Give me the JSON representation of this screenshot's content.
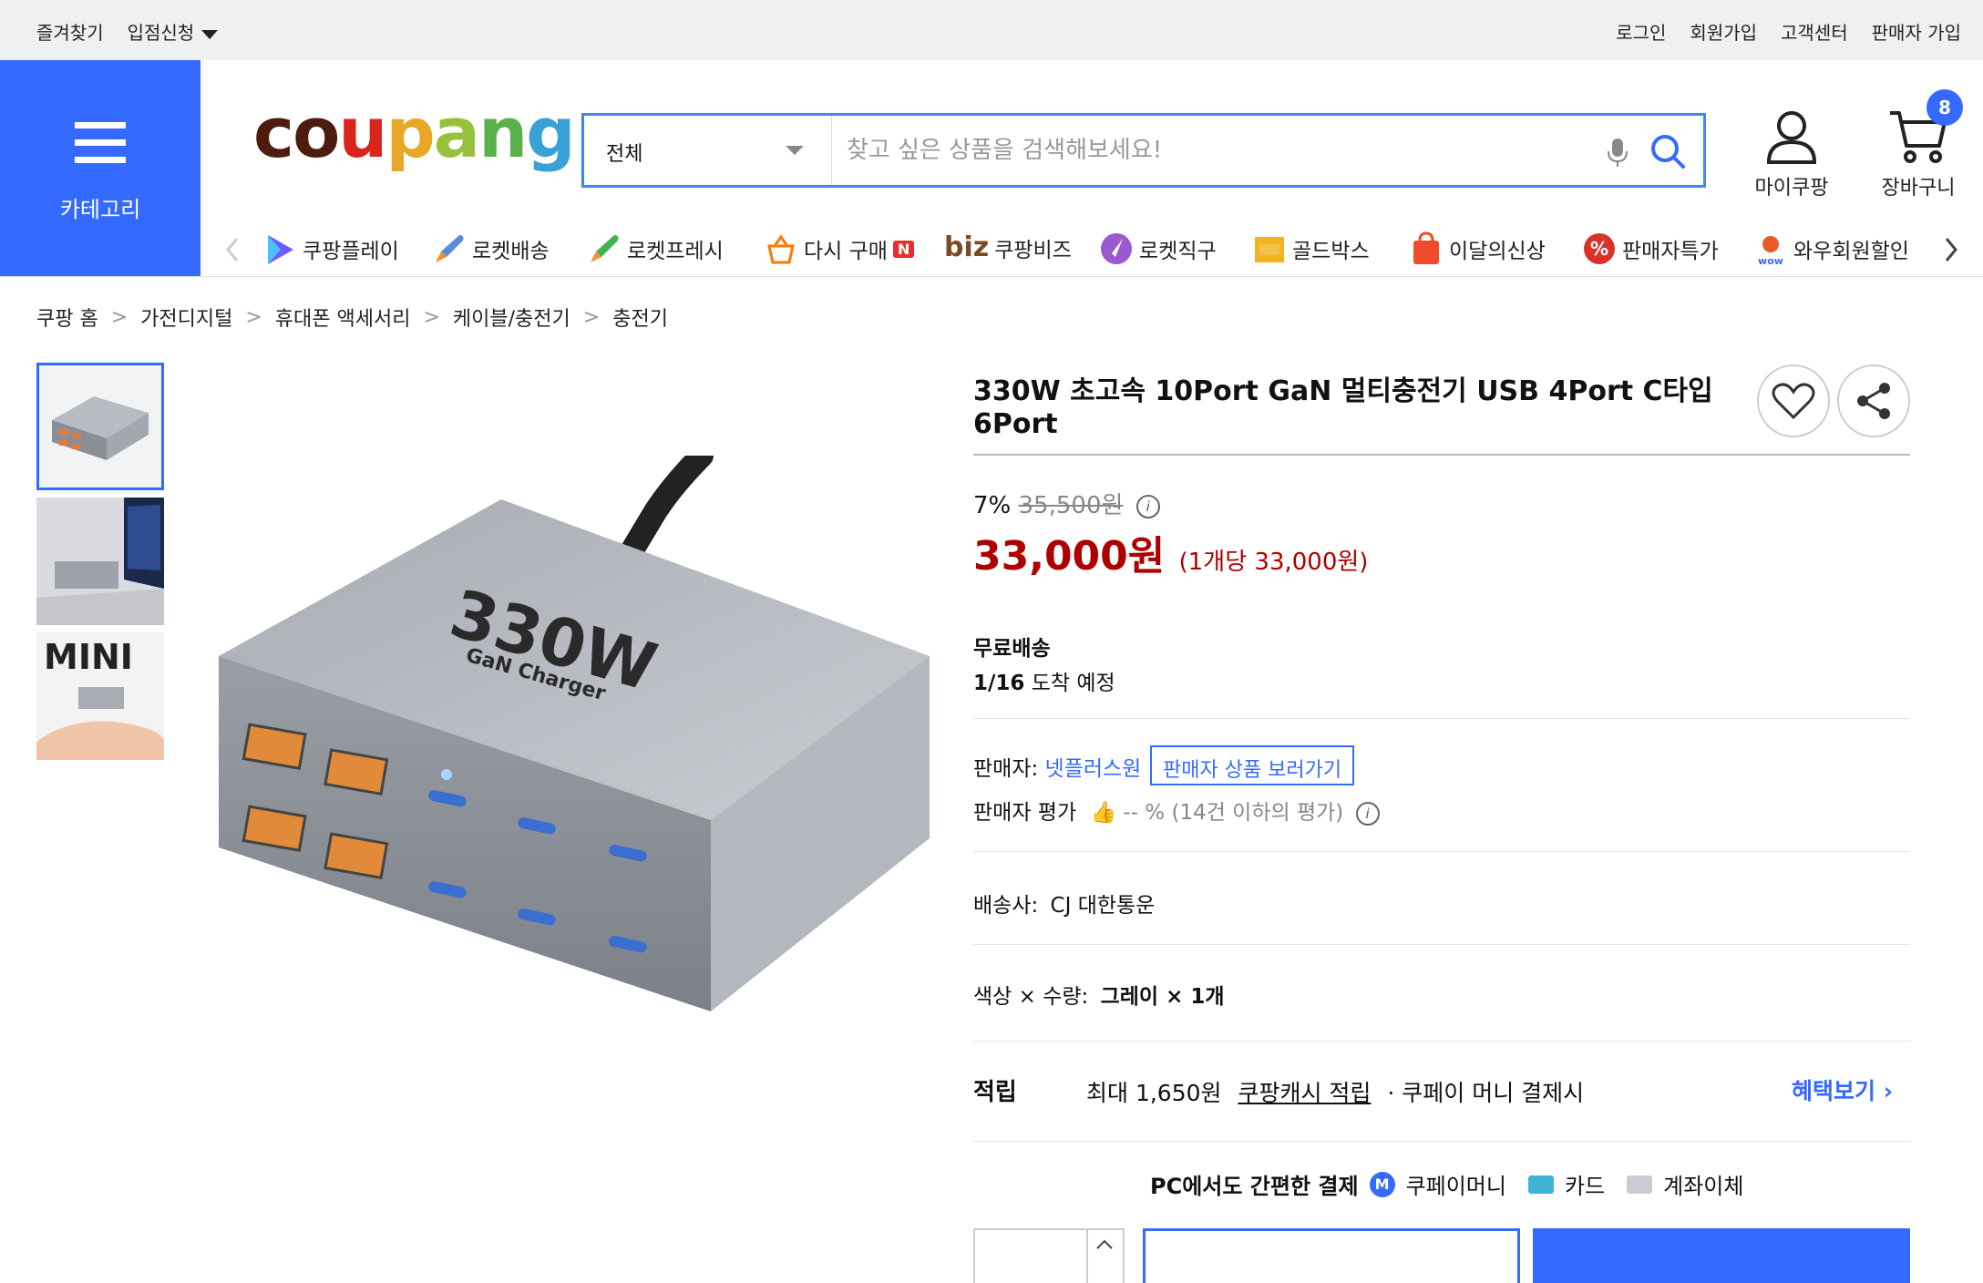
{
  "topbar": {
    "favorites": "즐겨찾기",
    "seller_apply": "입점신청",
    "login": "로그인",
    "signup": "회원가입",
    "customer_center": "고객센터",
    "seller_join": "판매자 가입"
  },
  "header": {
    "category_label": "카테고리",
    "logo": "coupang",
    "search_category": "전체",
    "search_placeholder": "찾고 싶은 상품을 검색해보세요!",
    "mycoupang_label": "마이쿠팡",
    "cart_label": "장바구니",
    "cart_count": "8"
  },
  "nav": [
    {
      "label": "쿠팡플레이",
      "icon": "play-icon"
    },
    {
      "label": "로켓배송",
      "icon": "rocket-icon"
    },
    {
      "label": "로켓프레시",
      "icon": "rocket-fresh-icon"
    },
    {
      "label": "다시 구매",
      "icon": "basket-icon",
      "badge": "N"
    },
    {
      "label": "쿠팡비즈",
      "icon": "biz-icon",
      "prefix": "biz"
    },
    {
      "label": "로켓직구",
      "icon": "rocket-global-icon"
    },
    {
      "label": "골드박스",
      "icon": "goldbox-icon"
    },
    {
      "label": "이달의신상",
      "icon": "new-bag-icon"
    },
    {
      "label": "판매자특가",
      "icon": "percent-icon"
    },
    {
      "label": "와우회원할인",
      "icon": "wow-icon"
    }
  ],
  "breadcrumb": [
    "쿠팡 홈",
    "가전디지털",
    "휴대폰 액세서리",
    "케이블/충전기",
    "충전기"
  ],
  "product": {
    "title": "330W 초고속 10Port GaN 멀티충전기 USB 4Port C타입 6Port",
    "discount_rate": "7%",
    "original_price": "35,500원",
    "sale_price": "33,000원",
    "unit_price": "(1개당 33,000원)",
    "image_text_main": "330W",
    "image_text_sub": "GaN Charger",
    "thumb3_text": "MINI"
  },
  "shipping": {
    "type": "무료배송",
    "arrival_date": "1/16",
    "arrival_suffix": "도착 예정"
  },
  "seller": {
    "label": "판매자:",
    "name": "넷플러스원",
    "view_products": "판매자 상품 보러가기",
    "rating_label": "판매자 평가",
    "rating_value": "-- %",
    "rating_note": "(14건 이하의 평가)"
  },
  "delivery": {
    "label": "배송사:",
    "carrier": "CJ 대한통운"
  },
  "option": {
    "label": "색상 × 수량:",
    "value": "그레이 × 1개"
  },
  "reward": {
    "label": "적립",
    "amount": "최대 1,650원",
    "cash_link": "쿠팡캐시 적립",
    "condition": "· 쿠페이 머니 결제시",
    "benefit_link": "혜택보기"
  },
  "payment": {
    "headline": "PC에서도 간편한 결제",
    "methods": [
      "쿠페이머니",
      "카드",
      "계좌이체"
    ]
  },
  "colors": {
    "brand_blue": "#346aff",
    "price_red": "#ae0000"
  }
}
